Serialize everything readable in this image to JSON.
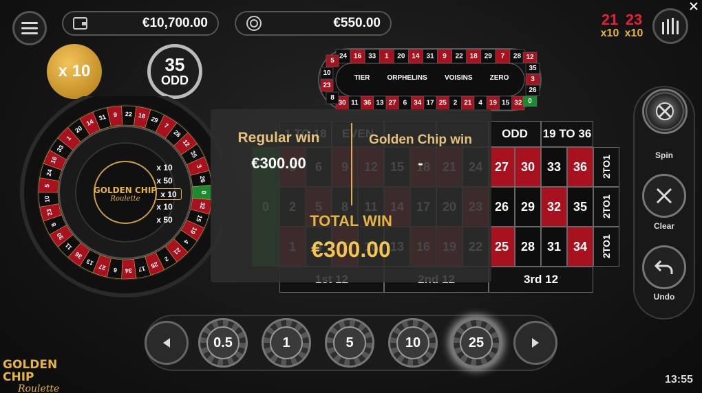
{
  "top_bar": {
    "balance": "€10,700.00",
    "total_bet": "€550.00",
    "hot_numbers": [
      {
        "number": "21",
        "multiplier": "x10"
      },
      {
        "number": "23",
        "multiplier": "x10"
      }
    ]
  },
  "badges": {
    "golden_multiplier": "x 10",
    "last_result_number": "35",
    "last_result_label": "ODD"
  },
  "wheel": {
    "logo_line1": "GOLDEN CHIP",
    "logo_line2": "Roulette",
    "multiplier_slots": [
      "x 10",
      "x 50",
      "x 10",
      "x 10",
      "x 50"
    ],
    "numbers": [
      "0",
      "32",
      "15",
      "19",
      "4",
      "21",
      "2",
      "25",
      "17",
      "34",
      "6",
      "27",
      "13",
      "36",
      "11",
      "30",
      "8",
      "23",
      "10",
      "5",
      "24",
      "16",
      "33",
      "1",
      "20",
      "14",
      "31",
      "9",
      "22",
      "18",
      "29",
      "7",
      "28",
      "12",
      "35",
      "3",
      "26"
    ]
  },
  "racetrack": {
    "top_row": [
      "24",
      "16",
      "33",
      "1",
      "20",
      "14",
      "31",
      "9",
      "22",
      "18",
      "29",
      "7",
      "28"
    ],
    "bottom_row": [
      "30",
      "11",
      "36",
      "13",
      "27",
      "6",
      "34",
      "17",
      "25",
      "2",
      "21",
      "4",
      "19",
      "15",
      "32"
    ],
    "left_end": [
      "5",
      "10",
      "23",
      "8"
    ],
    "right_end": [
      "12",
      "35",
      "3",
      "26",
      "0"
    ],
    "sections": [
      "TIER",
      "ORPHELINS",
      "VOISINS",
      "ZERO"
    ]
  },
  "table": {
    "rows": [
      [
        "3",
        "6",
        "9",
        "12",
        "15",
        "18",
        "21",
        "24",
        "27",
        "30",
        "33",
        "36"
      ],
      [
        "2",
        "5",
        "8",
        "11",
        "14",
        "17",
        "20",
        "23",
        "26",
        "29",
        "32",
        "35"
      ],
      [
        "1",
        "4",
        "7",
        "10",
        "13",
        "16",
        "19",
        "22",
        "25",
        "28",
        "31",
        "34"
      ]
    ],
    "zero": "0",
    "columns": [
      "2TO1",
      "2TO1",
      "2TO1"
    ],
    "dozens": [
      "1st 12",
      "2nd 12",
      "3rd 12"
    ],
    "outside_top": [
      "1 TO 18",
      "EVEN",
      "",
      "",
      "ODD",
      "19 TO 36"
    ]
  },
  "win_overlay": {
    "regular_label": "Regular win",
    "regular_amount": "€300.00",
    "golden_label": "Golden Chip win",
    "golden_amount": "-",
    "total_label": "TOTAL WIN",
    "total_amount": "€300.00"
  },
  "controls": {
    "spin_label": "Spin",
    "clear_label": "Clear",
    "undo_label": "Undo"
  },
  "chips": [
    "0.5",
    "1",
    "5",
    "10",
    "25"
  ],
  "footer": {
    "logo_line1": "GOLDEN CHIP",
    "logo_line2": "Roulette",
    "clock": "13:55"
  },
  "colors": {
    "red": "#a8121e",
    "black": "#0d0d0d",
    "gold": "#e6b540",
    "green": "#1c8a2e"
  },
  "icons": [
    "menu-icon",
    "wallet-icon",
    "chip-icon",
    "stats-icon",
    "close-icon",
    "spin-wheel-icon",
    "clear-icon",
    "undo-icon",
    "arrow-left-icon",
    "arrow-right-icon"
  ]
}
